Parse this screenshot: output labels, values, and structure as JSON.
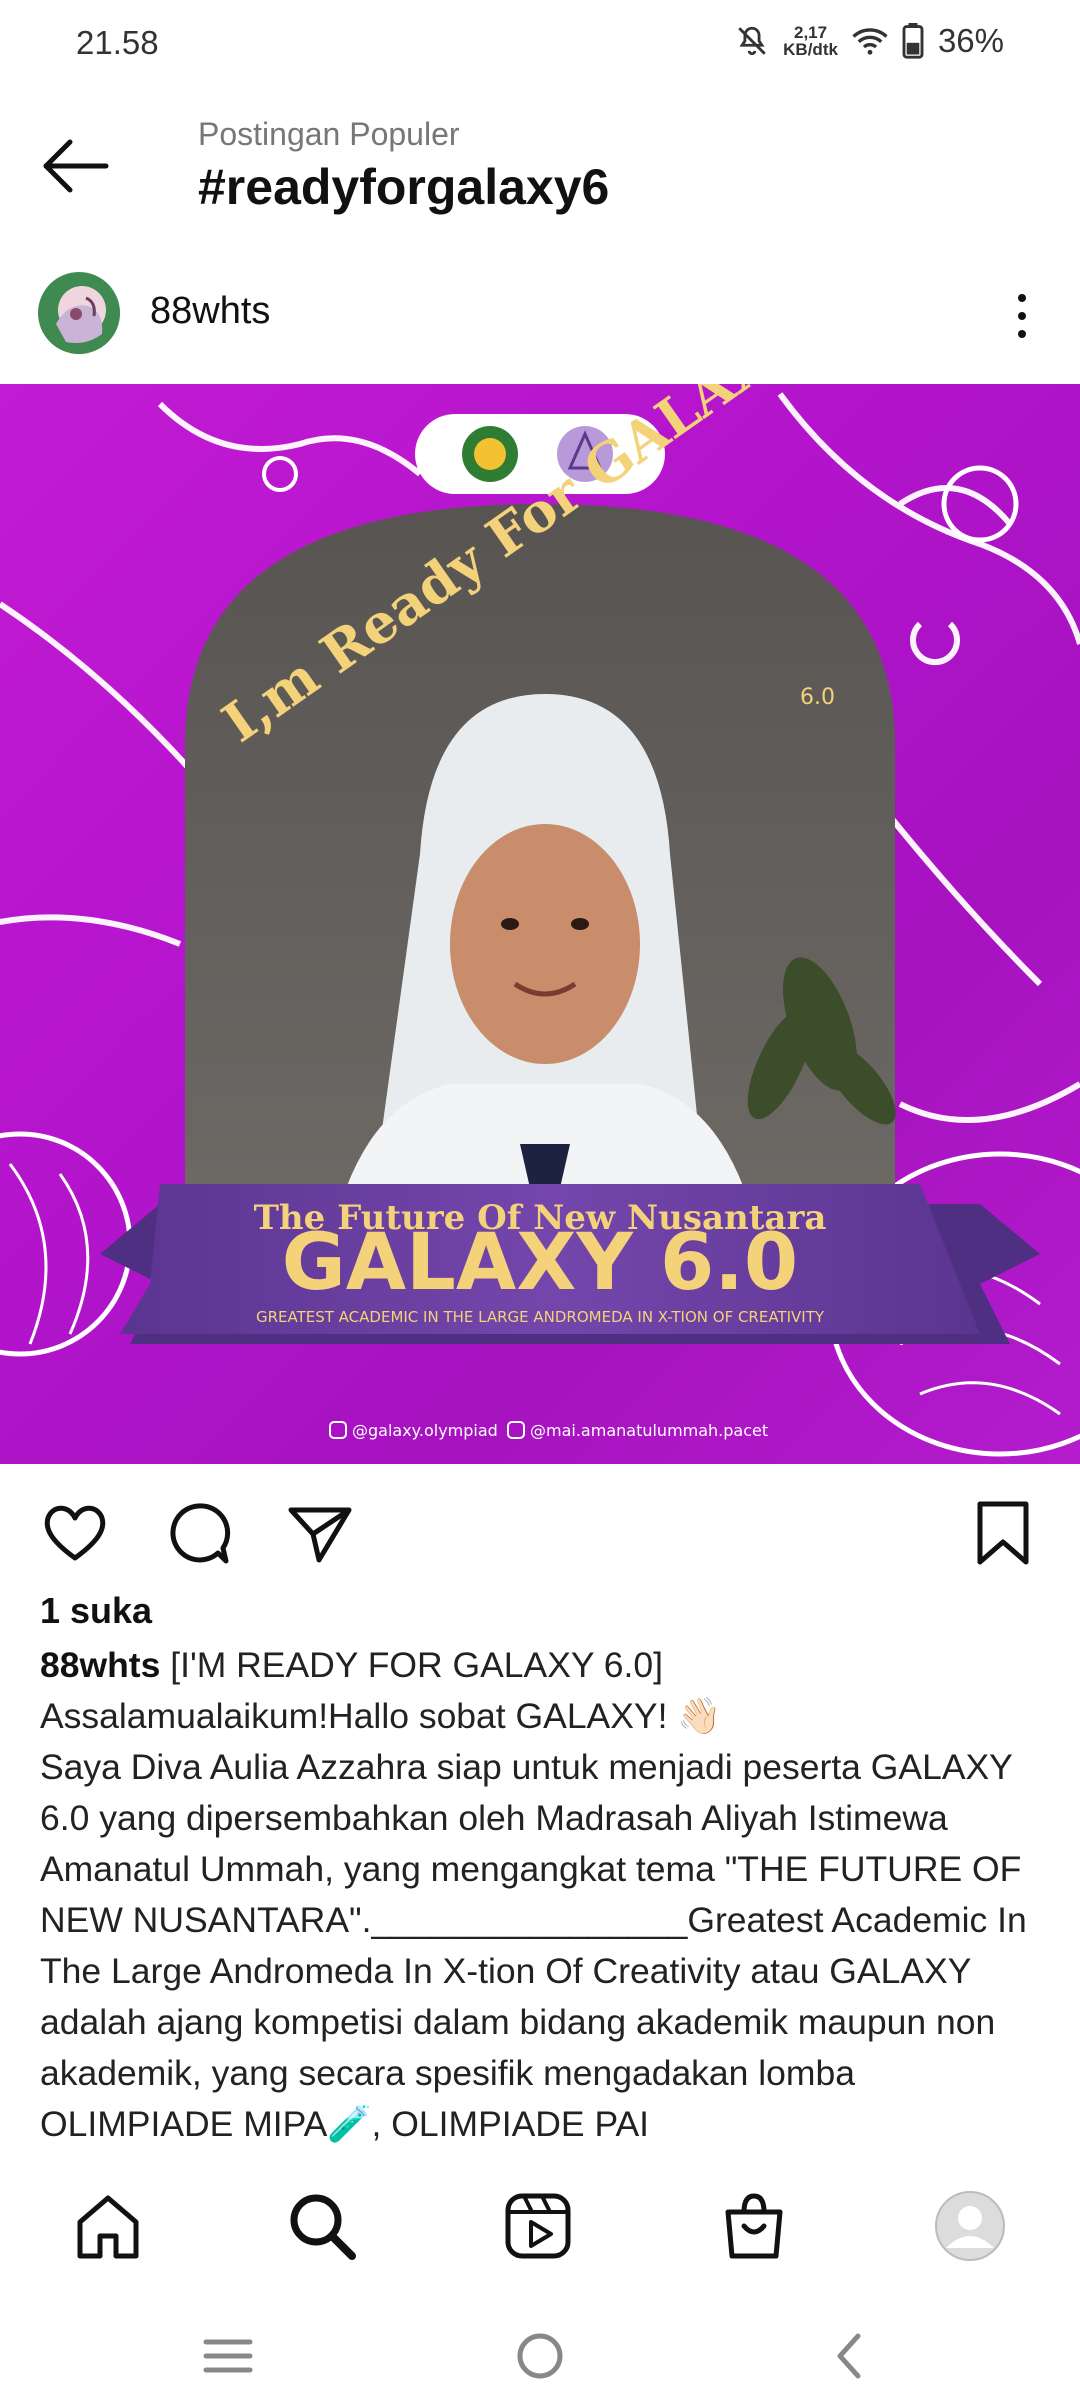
{
  "status": {
    "time": "21.58",
    "net_speed_value": "2,17",
    "net_speed_unit": "KB/dtk",
    "battery": "36%"
  },
  "header": {
    "subtitle": "Postingan Populer",
    "title": "#readyforgalaxy6"
  },
  "post": {
    "username": "88whts",
    "image": {
      "top_text": "I,m Ready For GALAXY",
      "version_small": "6.0",
      "ribbon_top": "The Future Of New Nusantara",
      "ribbon_main": "GALAXY 6.0",
      "ribbon_sub": "GREATEST ACADEMIC IN THE LARGE ANDROMEDA IN X-TION OF CREATIVITY",
      "handle_1": "@galaxy.olympiad",
      "handle_2": "@mai.amanatulummah.pacet"
    },
    "likes": "1 suka",
    "caption_user": "88whts",
    "caption_text": " [I'M READY FOR GALAXY 6.0]\nAssalamualaikum!Hallo sobat GALAXY! 👋🏻\nSaya Diva Aulia Azzahra siap untuk menjadi peserta GALAXY 6.0 yang dipersembahkan oleh Madrasah Aliyah Istimewa Amanatul Ummah, yang mengangkat tema \"THE FUTURE OF NEW NUSANTARA\".________________Greatest Academic In The Large Andromeda In X-tion Of Creativity atau GALAXY adalah ajang kompetisi dalam bidang akademik maupun non akademik, yang secara spesifik mengadakan lomba OLIMPIADE MIPA🧪, OLIMPIADE PAI"
  },
  "colors": {
    "bg_magenta": "#b314cc",
    "arch_gold": "#f3d27a",
    "ribbon_purple": "#6a3fa0"
  }
}
